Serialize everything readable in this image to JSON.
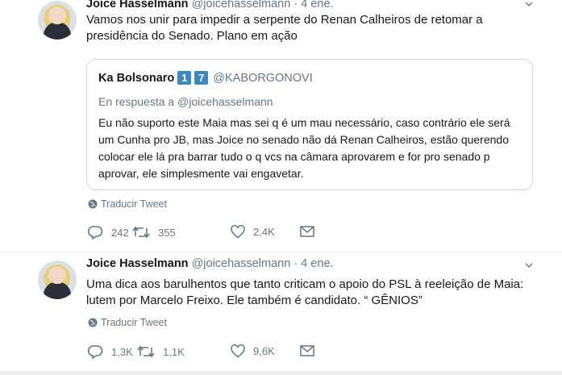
{
  "tweets": [
    {
      "name": "Joice Hasselmann",
      "handle": "@joicehasselmann",
      "dot": "·",
      "date": "4 ene.",
      "text": "Vamos nos unir para impedir a serpente do Renan Calheiros de retomar a presidência do Senado. Plano em ação",
      "quote": {
        "name": "Ka Bolsonaro",
        "emoji": [
          "1",
          "7"
        ],
        "handle": "@KABORGONOVI",
        "reply_to": "En respuesta a @joicehasselmann",
        "text": "Eu não suporto este Maia mas sei q é um mau necessário, caso contrário ele será um Cunha pro JB, mas Joice no senado não dá Renan Calheiros, estão querendo colocar ele lá pra barrar tudo o q vcs na câmara aprovarem e for pro senado p aprovar, ele simplesmente vai engavetar."
      },
      "translate": "Traducir Tweet",
      "replies": "242",
      "retweets": "355",
      "likes": "2,4K"
    },
    {
      "name": "Joice Hasselmann",
      "handle": "@joicehasselmann",
      "dot": "·",
      "date": "4 ene.",
      "text": "Uma dica aos barulhentos que tanto criticam o apoio do PSL à reeleição de Maia: lutem por Marcelo Freixo. Ele também é candidato. “ GÊNIOS”",
      "translate": "Traducir Tweet",
      "replies": "1,3K",
      "retweets": "1,1K",
      "likes": "9,6K"
    }
  ],
  "icons": {
    "caret": "chevron-down-icon",
    "globe": "globe-icon",
    "reply": "reply-icon",
    "retweet": "retweet-icon",
    "like": "heart-icon",
    "dm": "envelope-icon"
  },
  "colors": {
    "text": "#14171a",
    "secondary": "#657786",
    "border": "#e6ecf0",
    "emoji_blue": "#3b88c3"
  }
}
